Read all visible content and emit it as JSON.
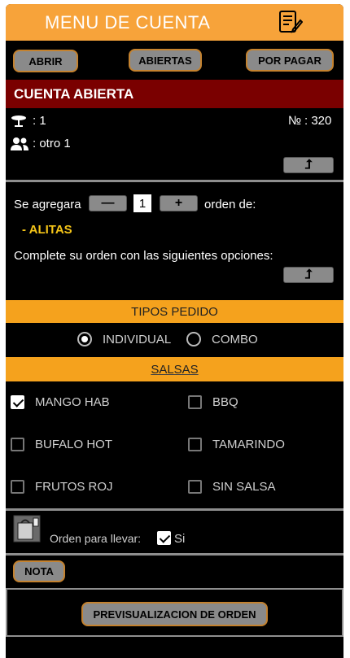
{
  "header": {
    "title": "MENU DE CUENTA",
    "icon": "edit-document-icon"
  },
  "toolbar": {
    "open_label": "ABRIR",
    "opened_label": "ABIERTAS",
    "pending_label": "POR PAGAR"
  },
  "account": {
    "banner": "CUENTA ABIERTA",
    "table_value": ": 1",
    "number_label": "№",
    "number_value": ": 320",
    "guest_value": ": otro 1",
    "expand_glyph": "⮥"
  },
  "order": {
    "prefix": "Se agregara",
    "minus": "—",
    "quantity": "1",
    "plus": "+",
    "suffix": "orden de:",
    "item": "- ALITAS",
    "instructions": "Complete su orden con las siguientes opciones:",
    "expand_glyph": "⮥"
  },
  "order_type": {
    "title": "TIPOS PEDIDO",
    "options": [
      {
        "label": "INDIVIDUAL",
        "selected": true
      },
      {
        "label": "COMBO",
        "selected": false
      }
    ]
  },
  "sauces": {
    "title": "SALSAS",
    "options": [
      {
        "label": "MANGO HAB",
        "checked": true
      },
      {
        "label": "BBQ",
        "checked": false
      },
      {
        "label": "BUFALO HOT",
        "checked": false
      },
      {
        "label": "TAMARINDO",
        "checked": false
      },
      {
        "label": "FRUTOS ROJ",
        "checked": false
      },
      {
        "label": "SIN SALSA",
        "checked": false
      }
    ]
  },
  "takeaway": {
    "label": "Orden para llevar:",
    "checked": true,
    "value": "Si",
    "icon": "takeaway-bag-icon"
  },
  "note": {
    "label": "NOTA"
  },
  "footer": {
    "preview_label": "PREVISUALIZACION DE ORDEN"
  },
  "colors": {
    "header": "#f7a33a",
    "banner": "#7a0000",
    "section": "#f5a21d",
    "item": "#f5c518"
  }
}
